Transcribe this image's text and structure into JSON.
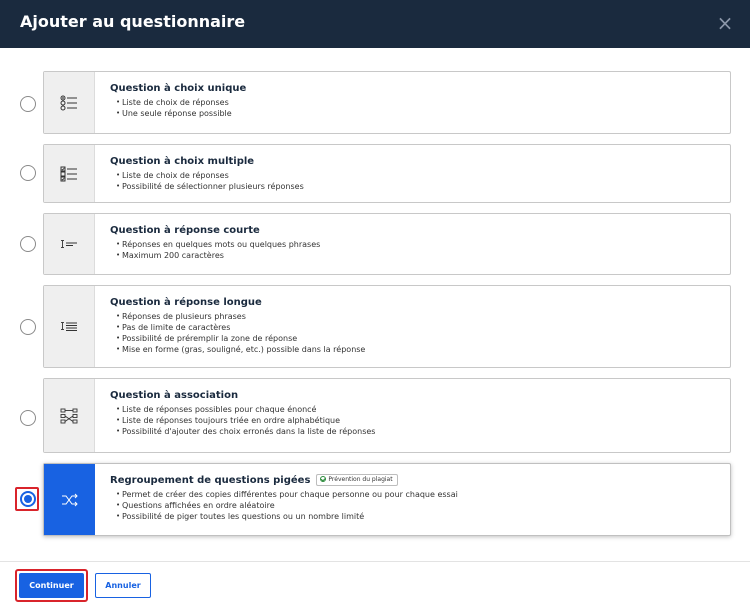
{
  "dialog": {
    "title": "Ajouter au questionnaire",
    "close_icon": "×"
  },
  "options": [
    {
      "title": "Question à choix unique",
      "icon": "single-choice-icon",
      "selected": false,
      "bullets": [
        "Liste de choix de réponses",
        "Une seule réponse possible"
      ]
    },
    {
      "title": "Question à choix multiple",
      "icon": "multiple-choice-icon",
      "selected": false,
      "bullets": [
        "Liste de choix de réponses",
        "Possibilité de sélectionner plusieurs réponses"
      ]
    },
    {
      "title": "Question à réponse courte",
      "icon": "short-answer-icon",
      "selected": false,
      "bullets": [
        "Réponses en quelques mots ou quelques phrases",
        "Maximum 200 caractères"
      ]
    },
    {
      "title": "Question à réponse longue",
      "icon": "long-answer-icon",
      "selected": false,
      "bullets": [
        "Réponses de plusieurs phrases",
        "Pas de limite de caractères",
        "Possibilité de préremplir la zone de réponse",
        "Mise en forme (gras, souligné, etc.) possible dans la réponse"
      ]
    },
    {
      "title": "Question à association",
      "icon": "matching-icon",
      "selected": false,
      "bullets": [
        "Liste de réponses possibles pour chaque énoncé",
        "Liste de réponses toujours triée en ordre alphabétique",
        "Possibilité d'ajouter des choix erronés dans la liste de réponses"
      ]
    },
    {
      "title": "Regroupement de questions pigées",
      "badge": "Prévention du plagiat",
      "icon": "shuffle-icon",
      "selected": true,
      "bullets": [
        "Permet de créer des copies différentes pour chaque personne ou pour chaque essai",
        "Questions affichées en ordre aléatoire",
        "Possibilité de piger toutes les questions ou un nombre limité"
      ]
    }
  ],
  "footer": {
    "continue_label": "Continuer",
    "cancel_label": "Annuler"
  },
  "colors": {
    "header_bg": "#1a2a3e",
    "accent": "#1862e2",
    "highlight": "#d9242b"
  }
}
